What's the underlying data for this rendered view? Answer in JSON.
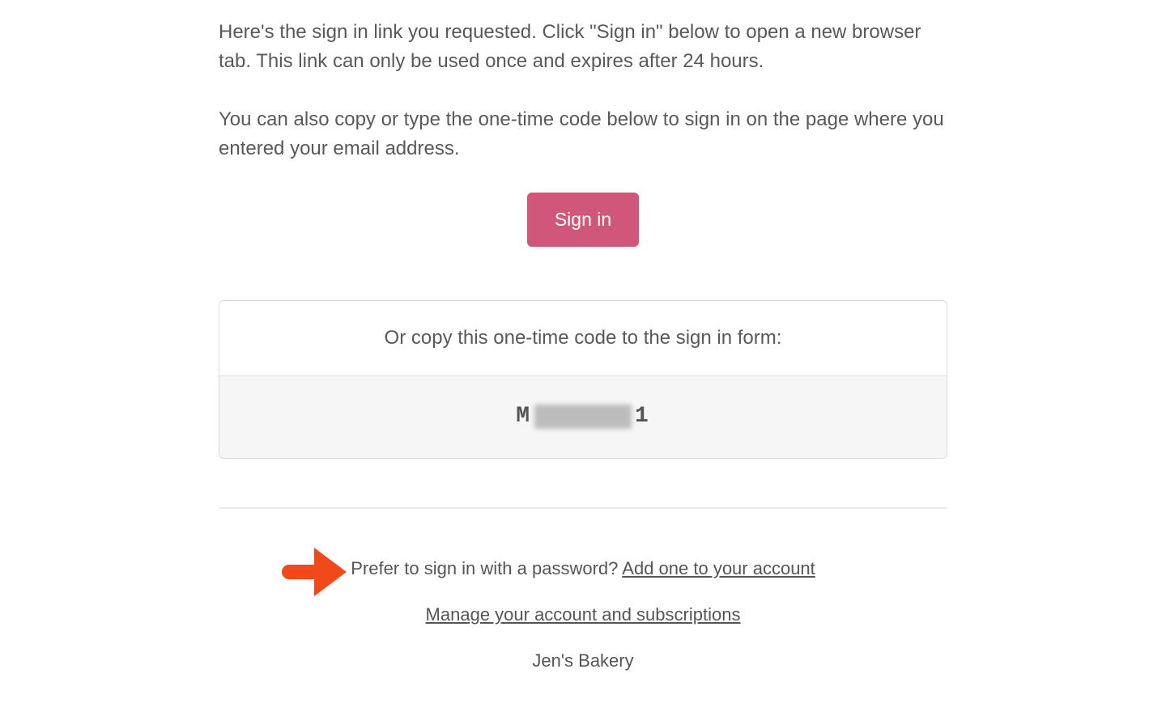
{
  "intro": {
    "para1": "Here's the sign in link you requested. Click \"Sign in\" below to open a new browser tab. This link can only be used once and expires after 24 hours.",
    "para2": "You can also copy or type the one-time code below to sign in on the page where you entered your email address."
  },
  "button": {
    "signin_label": "Sign in"
  },
  "codebox": {
    "header": "Or copy this one-time code to the sign in form:",
    "code_prefix": "M",
    "code_suffix": "1",
    "code_obscured": true
  },
  "footer": {
    "password_prompt": "Prefer to sign in with a password? ",
    "password_link": "Add one to your account",
    "manage_link": "Manage your account and subscriptions",
    "brand": "Jen's Bakery"
  },
  "colors": {
    "accent": "#d1577a",
    "annotation": "#f14a1a",
    "text": "#595959"
  }
}
